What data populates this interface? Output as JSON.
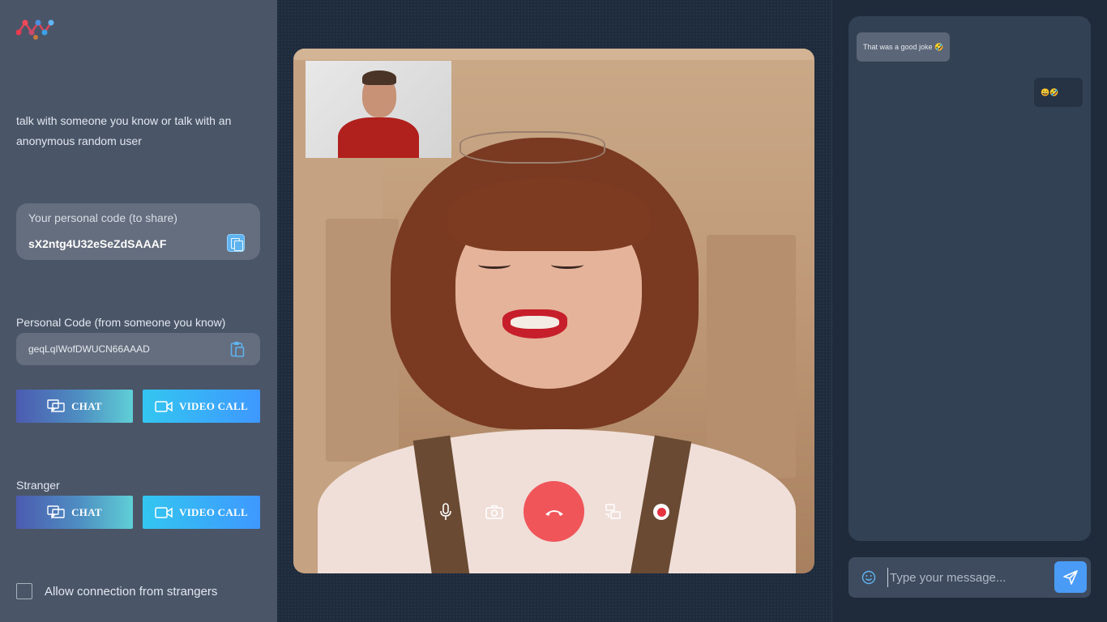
{
  "sidebar": {
    "tagline": "talk with someone you know or talk with an anonymous random user",
    "personal_code": {
      "label": "Your personal code (to share)",
      "value": "sX2ntg4U32eSeZdSAAAF"
    },
    "friend_code": {
      "label": "Personal Code (from someone you know)",
      "value": "geqLqIWofDWUCN66AAAD"
    },
    "known_buttons": {
      "chat": "CHAT",
      "video": "VIDEO CALL"
    },
    "stranger": {
      "label": "Stranger",
      "chat": "CHAT",
      "video": "VIDEO CALL"
    },
    "allow_strangers": {
      "label": "Allow connection from strangers",
      "checked": false
    }
  },
  "chat": {
    "messages": [
      {
        "direction": "incoming",
        "text": "That was a good joke 🤣"
      },
      {
        "direction": "outgoing",
        "text": "😄🤣"
      }
    ],
    "input": {
      "placeholder": "Type your message..."
    }
  },
  "colors": {
    "sidebar_bg": "#4a5568",
    "accent_blue": "#3e98ff",
    "hangup_red": "#f0555a",
    "record_red": "#e53340"
  },
  "icons": {
    "controls": [
      "microphone-icon",
      "camera-icon",
      "hangup-icon",
      "screen-share-icon",
      "record-icon"
    ]
  }
}
